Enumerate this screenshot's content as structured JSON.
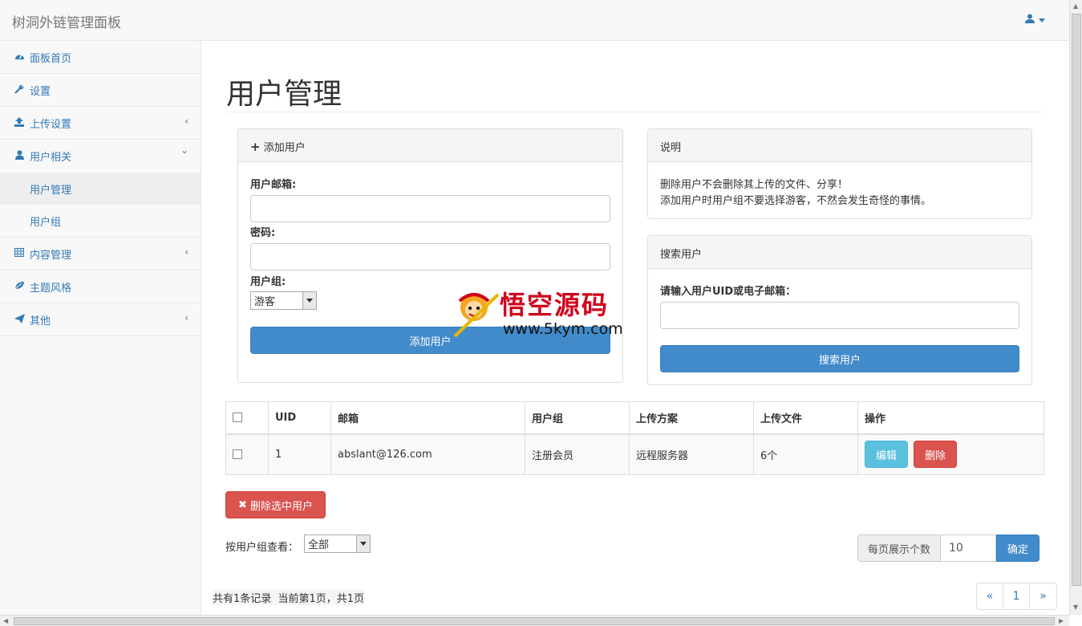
{
  "navbar": {
    "brand": "树洞外链管理面板"
  },
  "sidebar": {
    "items": [
      {
        "label": "面板首页",
        "icon": "dashboard-icon"
      },
      {
        "label": "设置",
        "icon": "wrench-icon"
      },
      {
        "label": "上传设置",
        "icon": "upload-icon",
        "arrow": "‹"
      },
      {
        "label": "用户相关",
        "icon": "user-icon",
        "arrow": "⌄"
      },
      {
        "label": "内容管理",
        "icon": "table-icon",
        "arrow": "‹"
      },
      {
        "label": "主题风格",
        "icon": "leaf-icon"
      },
      {
        "label": "其他",
        "icon": "send-icon",
        "arrow": "‹"
      }
    ],
    "sub": [
      {
        "label": "用户管理"
      },
      {
        "label": "用户组"
      }
    ]
  },
  "main": {
    "title": "用户管理",
    "add_panel": {
      "heading": "添加用户",
      "email_label": "用户邮箱:",
      "password_label": "密码:",
      "group_label": "用户组:",
      "group_value": "游客",
      "submit": "添加用户"
    },
    "info_panel": {
      "heading": "说明",
      "line1": "删除用户不会删除其上传的文件、分享！",
      "line2": "添加用户时用户组不要选择游客，不然会发生奇怪的事情。"
    },
    "search_panel": {
      "heading": "搜索用户",
      "label": "请输入用户UID或电子邮箱：",
      "submit": "搜索用户"
    },
    "table": {
      "headers": [
        "UID",
        "邮箱",
        "用户组",
        "上传方案",
        "上传文件",
        "操作"
      ],
      "rows": [
        {
          "uid": "1",
          "email": "abslant@126.com",
          "group": "注册会员",
          "policy": "远程服务器",
          "files": "6个",
          "edit": "编辑",
          "delete": "删除"
        }
      ]
    },
    "delete_selected": "删除选中用户",
    "filter_label": "按用户组查看：",
    "filter_value": "全部",
    "per_page_label": "每页展示个数",
    "per_page_value": "10",
    "per_page_confirm": "确定",
    "summary": "共有1条记录  当前第1页，共1页",
    "pager": [
      "«",
      "1",
      "»"
    ]
  },
  "watermark": {
    "title": "悟空源码",
    "url": "www.5kym.com"
  }
}
